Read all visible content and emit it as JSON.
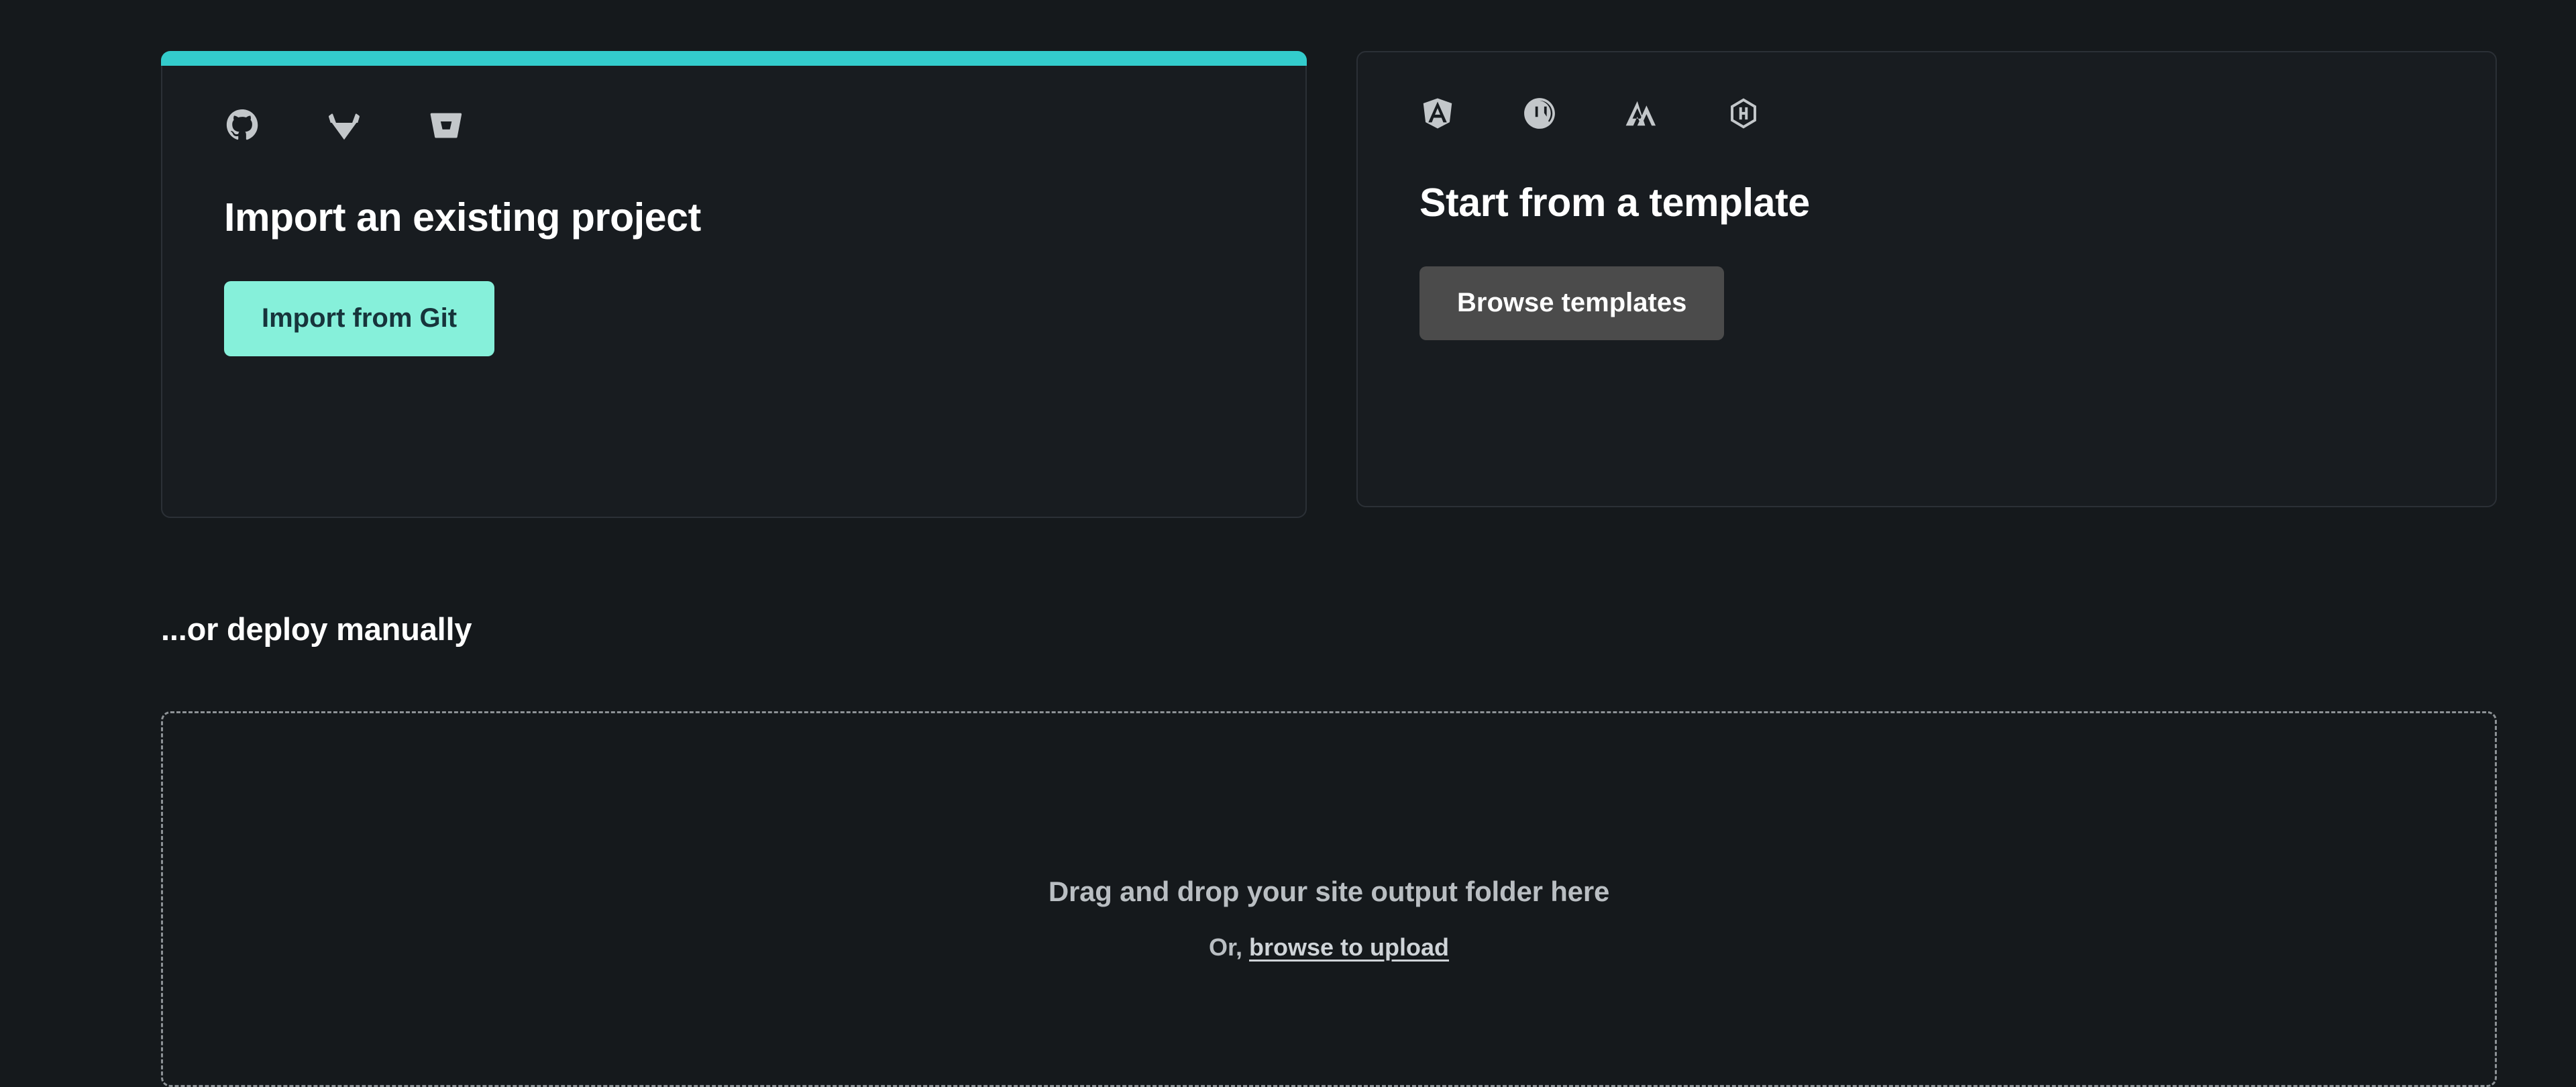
{
  "theme": {
    "background": "#15191c",
    "card_background": "#181c20",
    "card_border": "#2b3036",
    "accent_teal": "#33cccc",
    "button_primary_bg": "#86f0da",
    "button_primary_text": "#17343b",
    "button_secondary_bg": "#4b4b4b",
    "button_secondary_text": "#ffffff",
    "icon_color": "#c3c7ca",
    "dropzone_border": "#8d9296",
    "muted_text": "#b9bec2"
  },
  "import_card": {
    "accent_color": "#33cccc",
    "title": "Import an existing project",
    "button_label": "Import from Git",
    "providers": [
      {
        "name": "github-icon",
        "label": "GitHub"
      },
      {
        "name": "gitlab-icon",
        "label": "GitLab"
      },
      {
        "name": "bitbucket-icon",
        "label": "Bitbucket"
      }
    ]
  },
  "template_card": {
    "title": "Start from a template",
    "button_label": "Browse templates",
    "frameworks": [
      {
        "name": "angular-icon",
        "label": "Angular"
      },
      {
        "name": "nextjs-icon",
        "label": "Next.js"
      },
      {
        "name": "gatsby-icon",
        "label": "Gatsby"
      },
      {
        "name": "hugo-icon",
        "label": "Hugo"
      }
    ]
  },
  "manual_deploy": {
    "heading": "...or deploy manually",
    "dropzone_title": "Drag and drop your site output folder here",
    "dropzone_prefix": "Or, ",
    "dropzone_link": "browse to upload"
  }
}
